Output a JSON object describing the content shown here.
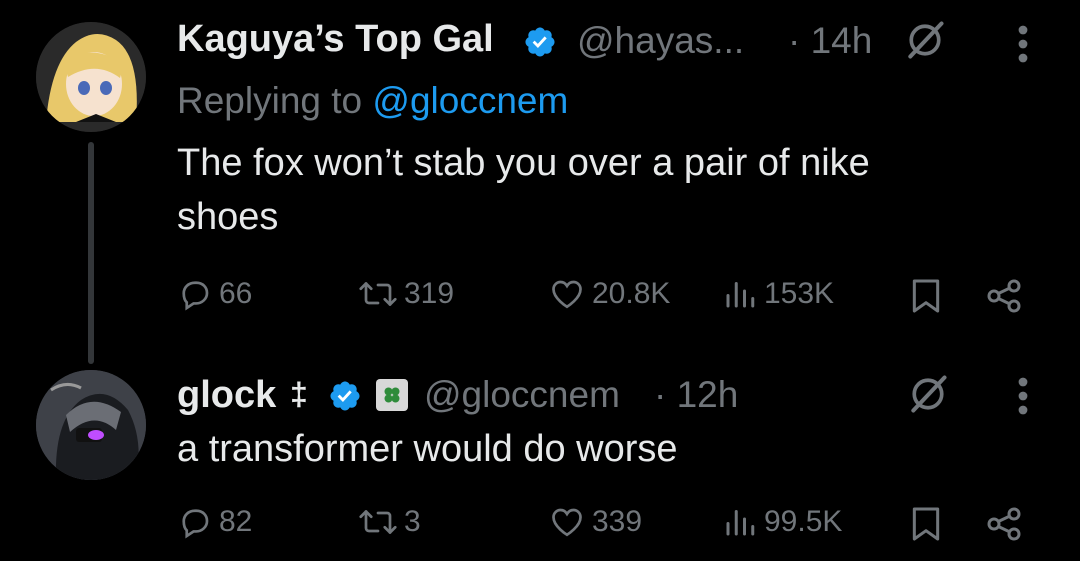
{
  "tweet1": {
    "display_name": "Kaguya’s Top Gal",
    "handle": "@hayas...",
    "time": "· 14h",
    "replying_prefix": "Replying to ",
    "replying_handle": "@gloccnem",
    "text_line1": "The fox won’t stab you over a pair of nike",
    "text_line2": "shoes",
    "replies": "66",
    "reposts": "319",
    "likes": "20.8K",
    "views": "153K"
  },
  "tweet2": {
    "display_name": "glock",
    "name_emoji": "‡",
    "handle": "@gloccnem",
    "time": "· 12h",
    "text": "a transformer would do worse",
    "replies": "82",
    "reposts": "3",
    "likes": "339",
    "views": "99.5K"
  },
  "colors": {
    "background": "#000000",
    "text": "#e7e9ea",
    "muted": "#71767b",
    "accent": "#1d9bf0"
  }
}
